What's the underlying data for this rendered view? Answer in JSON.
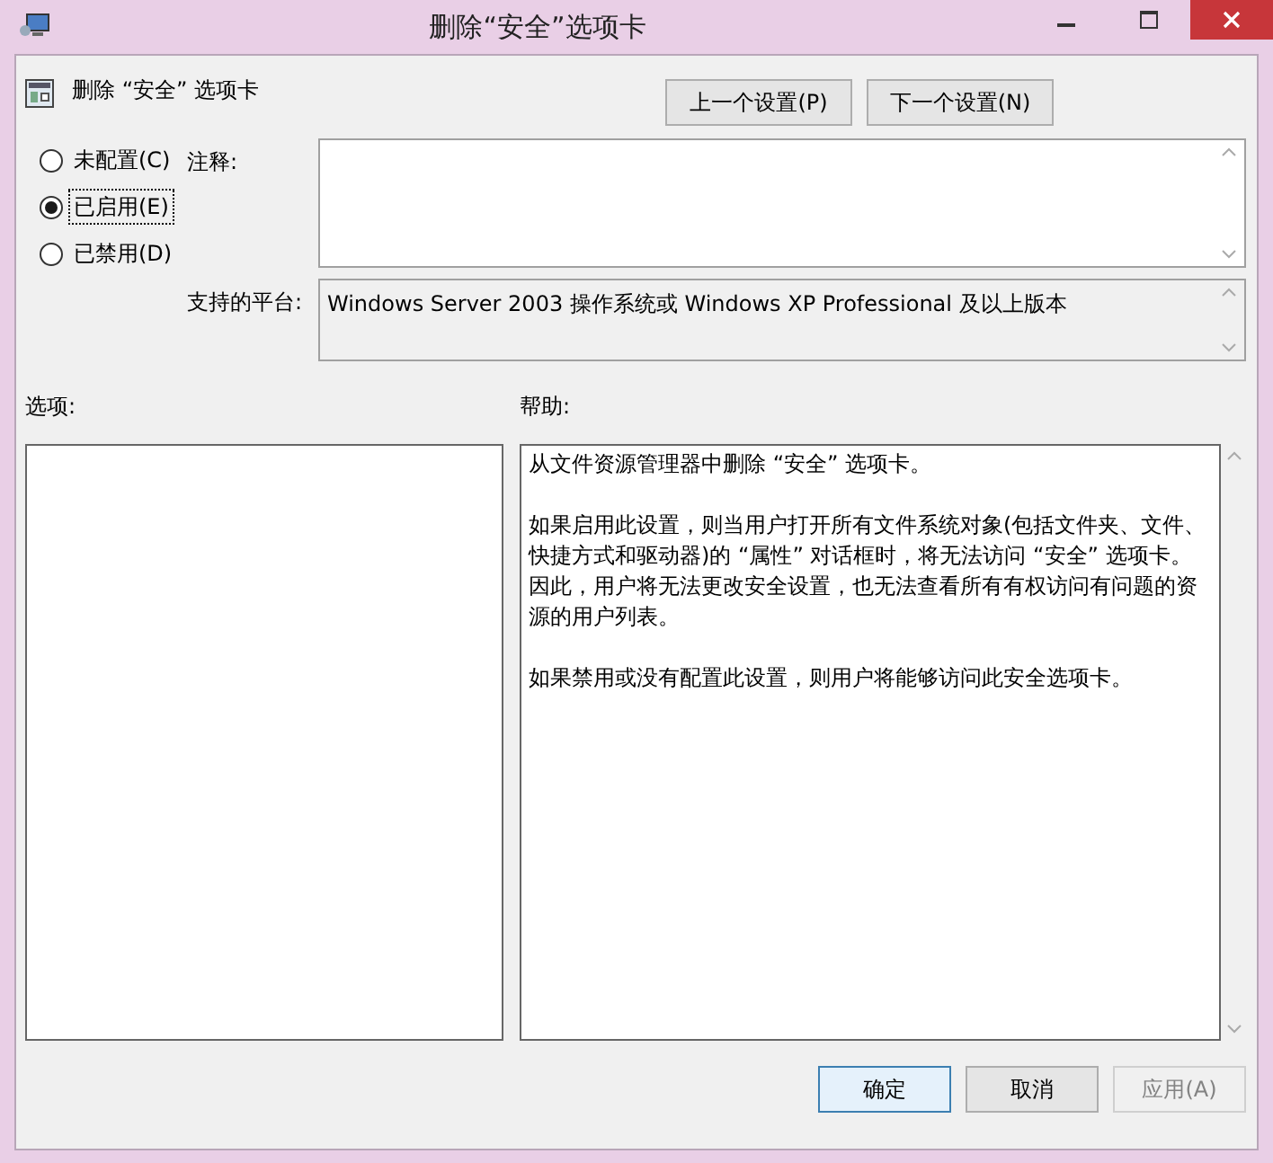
{
  "window": {
    "title": "删除“安全”选项卡"
  },
  "header": {
    "policy_name": "删除 “安全” 选项卡",
    "buttons": [
      {
        "label": "上一个设置(P)"
      },
      {
        "label": "下一个设置(N)"
      }
    ]
  },
  "states": [
    {
      "label": "未配置(C)",
      "selected": false
    },
    {
      "label": "已启用(E)",
      "selected": true
    },
    {
      "label": "已禁用(D)",
      "selected": false
    }
  ],
  "comment": {
    "label": "注释:"
  },
  "platform": {
    "label": "支持的平台:",
    "value": "Windows Server 2003 操作系统或 Windows XP Professional 及以上版本"
  },
  "options": {
    "label": "选项:"
  },
  "help": {
    "label": "帮助:",
    "paragraphs": [
      "从文件资源管理器中删除 “安全” 选项卡。",
      "如果启用此设置，则当用户打开所有文件系统对象(包括文件夹、文件、快捷方式和驱动器)的 “属性” 对话框时，将无法访问 “安全” 选项卡。因此，用户将无法更改安全设置，也无法查看所有有权访问有问题的资源的用户列表。",
      "如果禁用或没有配置此设置，则用户将能够访问此安全选项卡。"
    ]
  },
  "footer_buttons": [
    {
      "label": "确定",
      "default": true,
      "disabled": false
    },
    {
      "label": "取消",
      "default": false,
      "disabled": false
    },
    {
      "label": "应用(A)",
      "default": false,
      "disabled": true
    }
  ]
}
